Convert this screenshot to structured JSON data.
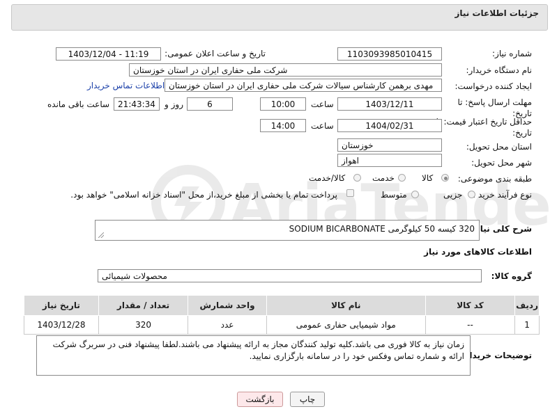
{
  "header": {
    "title": "جزئیات اطلاعات نیاز"
  },
  "labels": {
    "need_number": "شماره نیاز:",
    "announce_datetime": "تاریخ و ساعت اعلان عمومی:",
    "buyer_org": "نام دستگاه خریدار:",
    "requester": "ایجاد کننده درخواست:",
    "deadline": "مهلت ارسال پاسخ: تا تاریخ:",
    "min_validity": "حداقل تاریخ اعتبار قیمت: تا تاریخ:",
    "time": "ساعت",
    "day_and": "روز و",
    "remaining": "ساعت باقی مانده",
    "province": "استان محل تحویل:",
    "city": "شهر محل تحویل:",
    "category": "طبقه بندی موضوعی:",
    "purchase_type": "نوع فرآیند خرید :",
    "description": "شرح کلی نیاز:",
    "goods_info": "اطلاعات کالاهای مورد نیاز",
    "goods_group": "گروه کالا:",
    "buyer_notes": "توضیحات خریدار:"
  },
  "fields": {
    "need_number": "1103093985010415",
    "announce_datetime": "1403/12/04 - 11:19",
    "buyer_org": "شرکت ملی حفاری ایران در استان خوزستان",
    "requester": "مهدی برهمن کارشناس سیالات شرکت ملی حفاری ایران در استان خوزستان",
    "contact_link": "اطلاعات تماس خریدار",
    "deadline_date": "1403/12/11",
    "deadline_time": "10:00",
    "days": "6",
    "remaining_time": "21:43:34",
    "validity_date": "1404/02/31",
    "validity_time": "14:00",
    "province": "خوزستان",
    "city": "اهواز",
    "description": "320 کیسه 50 کیلوگرمی SODIUM BICARBONATE",
    "goods_group": "محصولات شیمیائی",
    "buyer_notes": "زمان نیاز به کالا فوری می باشد.کلیه تولید کنندگان مجاز به ارائه پیشنهاد می باشند.لطفا پیشنهاد فنی در سربرگ شرکت ارائه و شماره تماس وفکس خود را در سامانه بارگزاری نمایید."
  },
  "category_options": [
    {
      "label": "کالا",
      "selected": true
    },
    {
      "label": "خدمت",
      "selected": false
    },
    {
      "label": "کالا/خدمت",
      "selected": false
    }
  ],
  "purchase_options": [
    {
      "label": "جزیی",
      "selected": false
    },
    {
      "label": "متوسط",
      "selected": false
    }
  ],
  "payment_note": "پرداخت تمام یا بخشی از مبلغ خرید،از محل \"اسناد خزانه اسلامی\" خواهد بود.",
  "table": {
    "headers": [
      "ردیف",
      "کد کالا",
      "نام کالا",
      "واحد شمارش",
      "تعداد / مقدار",
      "تاریخ نیاز"
    ],
    "rows": [
      [
        "1",
        "--",
        "مواد شیمیایی حفاری عمومی",
        "عدد",
        "320",
        "1403/12/28"
      ]
    ]
  },
  "buttons": {
    "print": "چاپ",
    "back": "بازگشت"
  },
  "watermark": "AriaTender.neT"
}
